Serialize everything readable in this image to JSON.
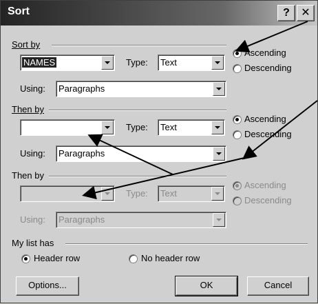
{
  "window": {
    "title": "Sort",
    "help_label": "?",
    "close_label": "✕"
  },
  "sort_by": {
    "group_label": "Sort by",
    "field_value": "NAMES",
    "type_label": "Type:",
    "type_value": "Text",
    "using_label": "Using:",
    "using_value": "Paragraphs",
    "ascending_label": "Ascending",
    "descending_label": "Descending",
    "order": "ascending"
  },
  "then_by_1": {
    "group_label": "Then by",
    "field_value": "",
    "type_label": "Type:",
    "type_value": "Text",
    "using_label": "Using:",
    "using_value": "Paragraphs",
    "ascending_label": "Ascending",
    "descending_label": "Descending",
    "order": "ascending"
  },
  "then_by_2": {
    "group_label": "Then by",
    "field_value": "",
    "type_label": "Type:",
    "type_value": "Text",
    "using_label": "Using:",
    "using_value": "Paragraphs",
    "ascending_label": "Ascending",
    "descending_label": "Descending",
    "order": "ascending",
    "disabled": true
  },
  "my_list_has": {
    "group_label": "My list has",
    "header_row_label": "Header row",
    "no_header_row_label": "No header row",
    "selected": "header_row"
  },
  "buttons": {
    "options_label": "Options...",
    "ok_label": "OK",
    "cancel_label": "Cancel"
  },
  "colors": {
    "title_bar": "#0a246a",
    "dialog_face": "#d4d0c8",
    "annotation_arrow": "#000000"
  }
}
